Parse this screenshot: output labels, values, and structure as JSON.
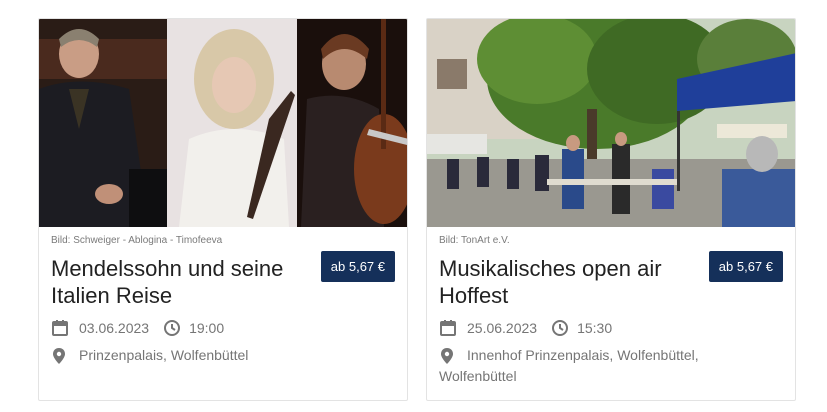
{
  "events": [
    {
      "credit": "Bild: Schweiger - Ablogina - Timofeeva",
      "title": "Mendelssohn und seine Italien Reise",
      "price": "ab 5,67 €",
      "date": "03.06.2023",
      "time": "19:00",
      "location": "Prinzenpalais, Wolfenbüttel"
    },
    {
      "credit": "Bild: TonArt e.V.",
      "title": "Musikalisches open air Hoffest",
      "price": "ab 5,67 €",
      "date": "25.06.2023",
      "time": "15:30",
      "location_line1": "Innenhof Prinzenpalais, Wolfenbüttel,",
      "location_line2": "Wolfenbüttel"
    }
  ],
  "icons": {
    "date": "calendar-icon",
    "time": "clock-icon",
    "location": "map-pin-icon"
  },
  "colors": {
    "price_bg": "#15305a",
    "meta_text": "#757575"
  }
}
